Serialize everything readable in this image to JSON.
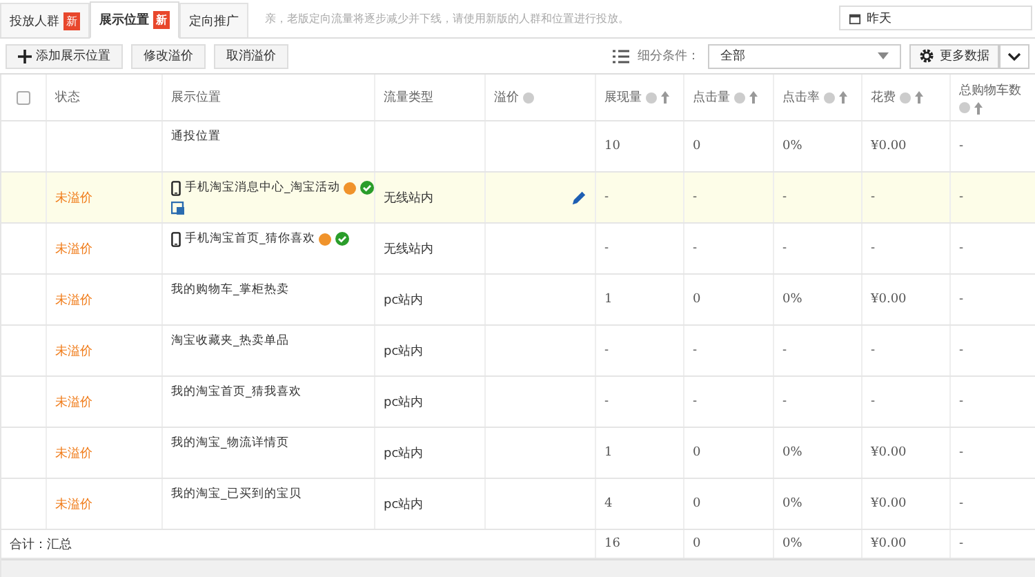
{
  "tabs": [
    {
      "label": "投放人群",
      "badge": "新",
      "selected": false
    },
    {
      "label": "展示位置",
      "badge": "新",
      "selected": true
    },
    {
      "label": "定向推广",
      "selected": false
    }
  ],
  "notice": "亲，老版定向流量将逐步减少并下线，请使用新版的人群和位置进行投放。",
  "date": "昨天",
  "buttons": [
    {
      "label": "添加展示位置",
      "kind": "add"
    },
    {
      "label": "修改溢价",
      "kind": "plain"
    },
    {
      "label": "取消溢价",
      "kind": "plain"
    }
  ],
  "filter": {
    "label": "细分条件：",
    "value": "全部"
  },
  "more_button": "更多数据",
  "select_all": {
    "checked": false
  },
  "columns": [
    {
      "label": "状态"
    },
    {
      "label": "展示位置"
    },
    {
      "label": "流量类型"
    },
    {
      "label": "溢价",
      "help": true
    },
    {
      "label": "展现量",
      "help": true,
      "sortable": true
    },
    {
      "label": "点击量",
      "help": true,
      "sortable": true
    },
    {
      "label": "点击率",
      "help": true,
      "sortable": true
    },
    {
      "label": "花费",
      "help": true,
      "sortable": true
    },
    {
      "label": "总购物车数",
      "help": true,
      "sortable": true
    }
  ],
  "rows": [
    {
      "position": "通投位置",
      "mobile": false,
      "help": false,
      "approved": false,
      "creative": false,
      "edit": false,
      "highlighted": false,
      "cells": [
        "10",
        "0",
        "0%",
        "¥0.00",
        "-"
      ]
    },
    {
      "status": "未溢价",
      "position": "手机淘宝消息中心_淘宝活动",
      "mobile": true,
      "help": true,
      "approved": true,
      "creative": true,
      "traffic": "无线站内",
      "edit": true,
      "highlighted": true,
      "cells": [
        "-",
        "-",
        "-",
        "-",
        "-"
      ]
    },
    {
      "status": "未溢价",
      "position": "手机淘宝首页_猜你喜欢",
      "mobile": true,
      "help": true,
      "approved": true,
      "creative": false,
      "traffic": "无线站内",
      "edit": false,
      "highlighted": false,
      "cells": [
        "-",
        "-",
        "-",
        "-",
        "-"
      ]
    },
    {
      "status": "未溢价",
      "position": "我的购物车_掌柜热卖",
      "mobile": false,
      "help": false,
      "approved": false,
      "creative": false,
      "traffic": "pc站内",
      "edit": false,
      "highlighted": false,
      "cells": [
        "1",
        "0",
        "0%",
        "¥0.00",
        "-"
      ]
    },
    {
      "status": "未溢价",
      "position": "淘宝收藏夹_热卖单品",
      "mobile": false,
      "help": false,
      "approved": false,
      "creative": false,
      "traffic": "pc站内",
      "edit": false,
      "highlighted": false,
      "cells": [
        "-",
        "-",
        "-",
        "-",
        "-"
      ]
    },
    {
      "status": "未溢价",
      "position": "我的淘宝首页_猜我喜欢",
      "mobile": false,
      "help": false,
      "approved": false,
      "creative": false,
      "traffic": "pc站内",
      "edit": false,
      "highlighted": false,
      "cells": [
        "-",
        "-",
        "-",
        "-",
        "-"
      ]
    },
    {
      "status": "未溢价",
      "position": "我的淘宝_物流详情页",
      "mobile": false,
      "help": false,
      "approved": false,
      "creative": false,
      "traffic": "pc站内",
      "edit": false,
      "highlighted": false,
      "cells": [
        "1",
        "0",
        "0%",
        "¥0.00",
        "-"
      ]
    },
    {
      "status": "未溢价",
      "position": "我的淘宝_已买到的宝贝",
      "mobile": false,
      "help": false,
      "approved": false,
      "creative": false,
      "traffic": "pc站内",
      "edit": false,
      "highlighted": false,
      "cells": [
        "4",
        "0",
        "0%",
        "¥0.00",
        "-"
      ]
    }
  ],
  "total": {
    "label": "合计：汇总",
    "cells": [
      "16",
      "0",
      "0%",
      "¥0.00",
      "-"
    ]
  }
}
